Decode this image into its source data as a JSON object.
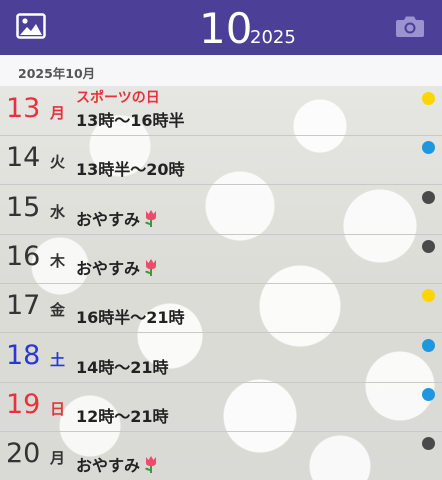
{
  "header": {
    "month": "10",
    "year": "2025",
    "left_icon": "image-icon",
    "right_icon": "camera-icon"
  },
  "subheader": {
    "label": "2025年10月"
  },
  "colors": {
    "header_bg": "#4b3f97",
    "holiday_text": "#e8313a",
    "saturday_text": "#2b36d6",
    "dot_yellow": "#ffd400",
    "dot_blue": "#1e96e0",
    "dot_dark": "#4a4a4a"
  },
  "days": [
    {
      "day": "13",
      "dow": "月",
      "holiday": "スポーツの日",
      "note": "13時〜16時半",
      "dot": "yellow",
      "color": "red",
      "tulip": false
    },
    {
      "day": "14",
      "dow": "火",
      "holiday": "",
      "note": "13時半〜20時",
      "dot": "blue",
      "color": "normal",
      "tulip": false
    },
    {
      "day": "15",
      "dow": "水",
      "holiday": "",
      "note": "おやすみ",
      "dot": "dark",
      "color": "normal",
      "tulip": true
    },
    {
      "day": "16",
      "dow": "木",
      "holiday": "",
      "note": "おやすみ",
      "dot": "dark",
      "color": "normal",
      "tulip": true
    },
    {
      "day": "17",
      "dow": "金",
      "holiday": "",
      "note": "16時半〜21時",
      "dot": "yellow",
      "color": "normal",
      "tulip": false
    },
    {
      "day": "18",
      "dow": "土",
      "holiday": "",
      "note": "14時〜21時",
      "dot": "blue",
      "color": "blue",
      "tulip": false
    },
    {
      "day": "19",
      "dow": "日",
      "holiday": "",
      "note": "12時〜21時",
      "dot": "blue",
      "color": "red",
      "tulip": false
    },
    {
      "day": "20",
      "dow": "月",
      "holiday": "",
      "note": "おやすみ",
      "dot": "dark",
      "color": "normal",
      "tulip": true
    }
  ]
}
